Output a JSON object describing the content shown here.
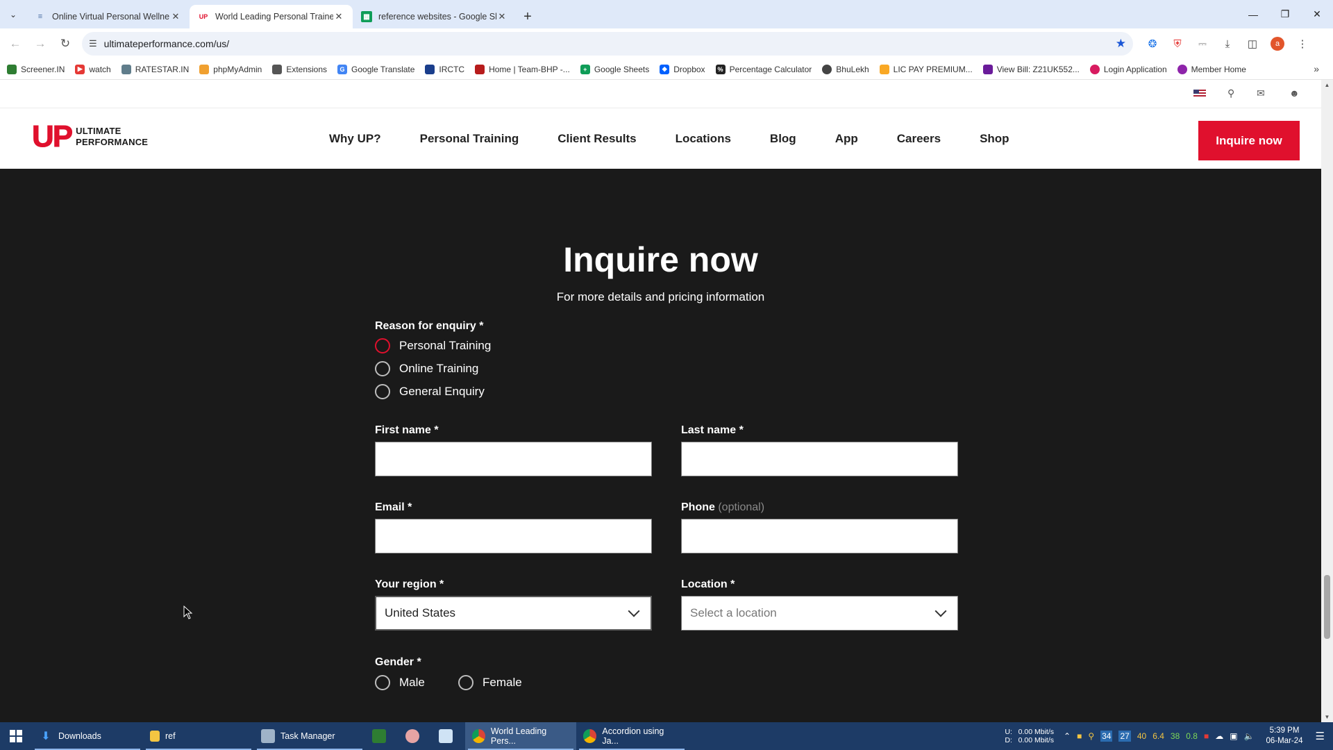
{
  "browser": {
    "tabs": [
      {
        "title": "Online Virtual Personal Wellne",
        "icon": "document-icon"
      },
      {
        "title": "World Leading Personal Trainer",
        "icon": "up-logo-icon"
      },
      {
        "title": "reference websites - Google Sh",
        "icon": "sheets-icon"
      }
    ],
    "url": "ultimateperformance.com/us/",
    "bookmarks": [
      {
        "label": "Screener.IN",
        "color": "#2e7d32"
      },
      {
        "label": "watch",
        "color": "#e53935"
      },
      {
        "label": "RATESTAR.IN",
        "color": "#607d8b"
      },
      {
        "label": "phpMyAdmin",
        "color": "#f0a030"
      },
      {
        "label": "Extensions",
        "color": "#555555"
      },
      {
        "label": "Google Translate",
        "color": "#4285f4"
      },
      {
        "label": "IRCTC",
        "color": "#1a3e8c"
      },
      {
        "label": "Home | Team-BHP -...",
        "color": "#b71c1c"
      },
      {
        "label": "Google Sheets",
        "color": "#0f9d58"
      },
      {
        "label": "Dropbox",
        "color": "#0061fe"
      },
      {
        "label": "Percentage Calculator",
        "color": "#222222"
      },
      {
        "label": "BhuLekh",
        "color": "#444444"
      },
      {
        "label": "LIC PAY PREMIUM...",
        "color": "#f9a825"
      },
      {
        "label": "View Bill: Z21UK552...",
        "color": "#6a1b9a"
      },
      {
        "label": "Login Application",
        "color": "#d81b60"
      },
      {
        "label": "Member Home",
        "color": "#8e24aa"
      }
    ]
  },
  "site": {
    "logo": {
      "mark": "UP",
      "line1": "ULTIMATE",
      "line2": "PERFORMANCE"
    },
    "nav": [
      "Why UP?",
      "Personal Training",
      "Client Results",
      "Locations",
      "Blog",
      "App",
      "Careers",
      "Shop"
    ],
    "cta": "Inquire now",
    "accent": "#e0102d"
  },
  "form": {
    "title": "Inquire now",
    "subtitle": "For more details and pricing information",
    "reason_label": "Reason for enquiry *",
    "reason_options": [
      "Personal Training",
      "Online Training",
      "General Enquiry"
    ],
    "reason_selected": "Personal Training",
    "first_name_label": "First name *",
    "last_name_label": "Last name *",
    "email_label": "Email *",
    "phone_label": "Phone",
    "phone_optional": "(optional)",
    "region_label": "Your region *",
    "region_value": "United States",
    "location_label": "Location *",
    "location_placeholder": "Select a location",
    "gender_label": "Gender *",
    "gender_options": [
      "Male",
      "Female"
    ]
  },
  "taskbar": {
    "items": [
      {
        "label": "Downloads",
        "icon": "download-folder-icon"
      },
      {
        "label": "ref",
        "icon": "folder-icon"
      },
      {
        "label": "Task Manager",
        "icon": "task-manager-icon"
      },
      {
        "label": "",
        "icon": "sheet-app-icon"
      },
      {
        "label": "",
        "icon": "app-icon"
      },
      {
        "label": "",
        "icon": "notepad-icon"
      },
      {
        "label": "World Leading Pers...",
        "icon": "chrome-icon"
      },
      {
        "label": "Accordion using Ja...",
        "icon": "chrome-icon"
      }
    ],
    "net_up": "0.00 Mbit/s",
    "net_down": "0.00 Mbit/s",
    "net_up_label": "U:",
    "net_down_label": "D:",
    "tray_numbers": [
      "34",
      "27",
      "40",
      "6.4",
      "38",
      "0.8"
    ],
    "time": "5:39 PM",
    "date": "06-Mar-24"
  }
}
